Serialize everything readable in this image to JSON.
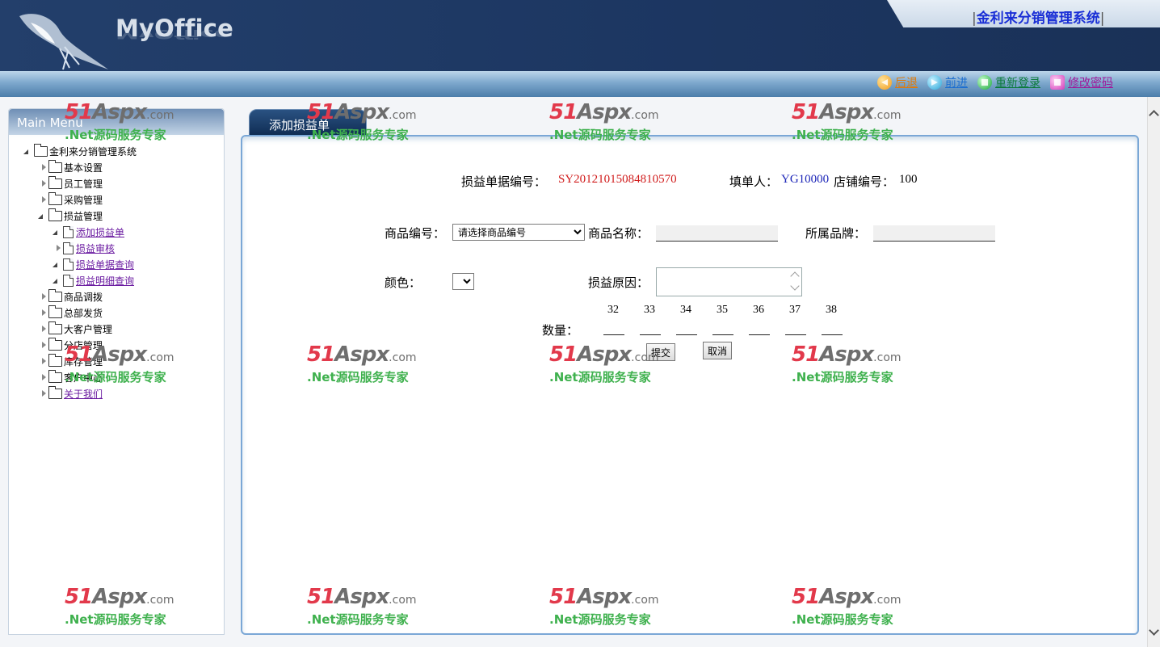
{
  "header": {
    "app_name": "MyOffice",
    "system_title": "金利来分销管理系统",
    "title_sep": "|",
    "links": [
      {
        "label": "后退",
        "icon": "back-arrow-icon"
      },
      {
        "label": "前进",
        "icon": "forward-arrow-icon"
      },
      {
        "label": "重新登录",
        "icon": "relogin-icon"
      },
      {
        "label": "修改密码",
        "icon": "change-password-icon"
      }
    ]
  },
  "sidebar": {
    "menu_title": "Main Menu",
    "tree": [
      {
        "label": "金利来分销管理系统",
        "level": 0,
        "expanded": true,
        "type": "folder"
      },
      {
        "label": "基本设置",
        "level": 1,
        "expanded": false,
        "type": "folder"
      },
      {
        "label": "员工管理",
        "level": 1,
        "expanded": false,
        "type": "folder"
      },
      {
        "label": "采购管理",
        "level": 1,
        "expanded": false,
        "type": "folder"
      },
      {
        "label": "损益管理",
        "level": 1,
        "expanded": true,
        "type": "folder"
      },
      {
        "label": "添加损益单",
        "level": 2,
        "expanded": true,
        "type": "page",
        "link": true
      },
      {
        "label": "损益审核",
        "level": 2,
        "expanded": false,
        "type": "page",
        "link": true
      },
      {
        "label": "损益单据查询",
        "level": 2,
        "expanded": true,
        "type": "page",
        "link": true
      },
      {
        "label": "损益明细查询",
        "level": 2,
        "expanded": true,
        "type": "page",
        "link": true
      },
      {
        "label": "商品调拨",
        "level": 1,
        "expanded": false,
        "type": "folder"
      },
      {
        "label": "总部发货",
        "level": 1,
        "expanded": false,
        "type": "folder"
      },
      {
        "label": "大客户管理",
        "level": 1,
        "expanded": false,
        "type": "folder"
      },
      {
        "label": "分店管理",
        "level": 1,
        "expanded": false,
        "type": "folder"
      },
      {
        "label": "库存管理",
        "level": 1,
        "expanded": false,
        "type": "folder"
      },
      {
        "label": "客户中心",
        "level": 1,
        "expanded": false,
        "type": "folder"
      },
      {
        "label": "关于我们",
        "level": 1,
        "expanded": false,
        "type": "folder",
        "link": true
      }
    ]
  },
  "main": {
    "tab_label": "添加损益单",
    "doc_no_label": "损益单据编号：",
    "doc_no_value": "SY20121015084810570",
    "filler_label": "填单人：",
    "filler_value": "YG10000",
    "store_label": "店铺编号：",
    "store_value": "100",
    "product_code_label": "商品编号：",
    "product_code_selected": "请选择商品编号",
    "product_name_label": "商品名称：",
    "product_name_value": "",
    "brand_label": "所属品牌：",
    "brand_value": "",
    "color_label": "颜色：",
    "color_selected": "",
    "reason_label": "损益原因：",
    "reason_value": "",
    "quantity_label": "数量：",
    "sizes": [
      "32",
      "33",
      "34",
      "35",
      "36",
      "37",
      "38"
    ],
    "submit_label": "提交",
    "cancel_label": "取消"
  },
  "watermark": {
    "brand_51": "51",
    "brand_aspx": "Aspx",
    "brand_com": ".com",
    "slogan": ".Net源码服务专家"
  },
  "colors": {
    "red_value": "#d01a1a",
    "blue_value": "#1c25b8",
    "link_purple": "#6a1aa0",
    "header_bg": "#1c3661"
  }
}
